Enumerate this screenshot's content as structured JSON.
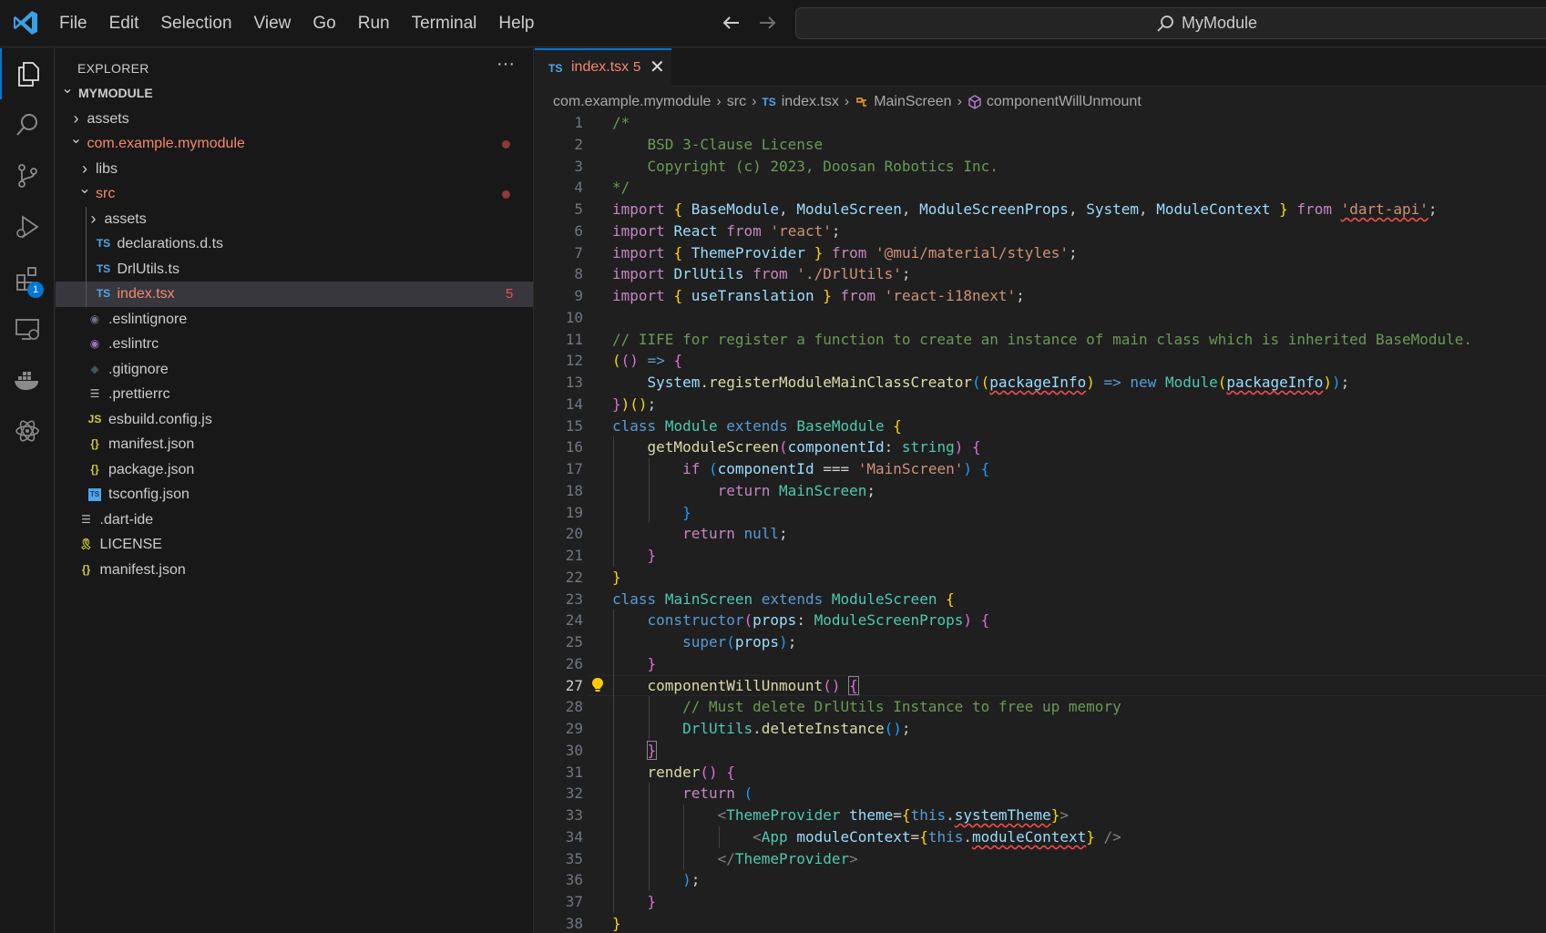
{
  "menu": [
    "File",
    "Edit",
    "Selection",
    "View",
    "Go",
    "Run",
    "Terminal",
    "Help"
  ],
  "search": {
    "text": "MyModule"
  },
  "activity": {
    "extensions_badge": "1"
  },
  "explorer": {
    "title": "EXPLORER",
    "more": "···",
    "tree": [
      {
        "label": "MYMODULE",
        "depth": 0,
        "chev": "open",
        "icon": "",
        "root": true
      },
      {
        "label": "assets",
        "depth": 1,
        "chev": "closed",
        "icon": ""
      },
      {
        "label": "com.example.mymodule",
        "depth": 1,
        "chev": "open",
        "icon": "",
        "modified": true,
        "color": "#f48771"
      },
      {
        "label": "libs",
        "depth": 2,
        "chev": "closed",
        "icon": ""
      },
      {
        "label": "src",
        "depth": 2,
        "chev": "open",
        "icon": "",
        "modified": true,
        "color": "#f48771"
      },
      {
        "label": "assets",
        "depth": 3,
        "chev": "closed",
        "icon": ""
      },
      {
        "label": "declarations.d.ts",
        "depth": 3,
        "icon": "TS",
        "iconColor": "#4fa6ed"
      },
      {
        "label": "DrlUtils.ts",
        "depth": 3,
        "icon": "TS",
        "iconColor": "#4fa6ed"
      },
      {
        "label": "index.tsx",
        "depth": 3,
        "icon": "TS",
        "iconColor": "#4fa6ed",
        "selected": true,
        "color": "#f48771",
        "count": "5"
      },
      {
        "label": ".eslintignore",
        "depth": 2,
        "icon": "◉",
        "iconColor": "#6b7387"
      },
      {
        "label": ".eslintrc",
        "depth": 2,
        "icon": "◉",
        "iconColor": "#a074c4"
      },
      {
        "label": ".gitignore",
        "depth": 2,
        "icon": "◆",
        "iconColor": "#41535b"
      },
      {
        "label": ".prettierrc",
        "depth": 2,
        "icon": "☰",
        "iconColor": "#bbbbbb"
      },
      {
        "label": "esbuild.config.js",
        "depth": 2,
        "icon": "JS",
        "iconColor": "#cbcb41"
      },
      {
        "label": "manifest.json",
        "depth": 2,
        "icon": "{}",
        "iconColor": "#cbcb41"
      },
      {
        "label": "package.json",
        "depth": 2,
        "icon": "{}",
        "iconColor": "#cbcb41"
      },
      {
        "label": "tsconfig.json",
        "depth": 2,
        "icon": "TS",
        "iconColor": "#4fa6ed",
        "boxed": true
      },
      {
        "label": ".dart-ide",
        "depth": 1,
        "icon": "☰",
        "iconColor": "#bbbbbb"
      },
      {
        "label": "LICENSE",
        "depth": 1,
        "icon": "🎗",
        "iconColor": "#cbcb41"
      },
      {
        "label": "manifest.json",
        "depth": 1,
        "icon": "{}",
        "iconColor": "#cbcb41"
      }
    ]
  },
  "tab": {
    "lang": "TS",
    "name": "index.tsx",
    "count": "5",
    "close": "✕"
  },
  "breadcrumb": {
    "package": "com.example.mymodule",
    "folder": "src",
    "lang": "TS",
    "file": "index.tsx",
    "class": "MainScreen",
    "method": "componentWillUnmount"
  },
  "editor": {
    "current_line": 27,
    "lines": [
      [
        [
          "c",
          "/*"
        ]
      ],
      [
        [
          "c",
          "    BSD 3-Clause License"
        ]
      ],
      [
        [
          "c",
          "    Copyright (c) 2023, Doosan Robotics Inc."
        ]
      ],
      [
        [
          "c",
          "*/"
        ]
      ],
      [
        [
          "ki",
          "import"
        ],
        [
          "p",
          " "
        ],
        [
          "b1",
          "{"
        ],
        [
          "p",
          " "
        ],
        [
          "v",
          "BaseModule"
        ],
        [
          "p",
          ", "
        ],
        [
          "v",
          "ModuleScreen"
        ],
        [
          "p",
          ", "
        ],
        [
          "v",
          "ModuleScreenProps"
        ],
        [
          "p",
          ", "
        ],
        [
          "v",
          "System"
        ],
        [
          "p",
          ", "
        ],
        [
          "v",
          "ModuleContext"
        ],
        [
          "p",
          " "
        ],
        [
          "b1",
          "}"
        ],
        [
          "p",
          " "
        ],
        [
          "ki",
          "from"
        ],
        [
          "p",
          " "
        ],
        [
          "s sq",
          "'dart-api'"
        ],
        [
          "p",
          ";"
        ]
      ],
      [
        [
          "ki",
          "import"
        ],
        [
          "p",
          " "
        ],
        [
          "v",
          "React"
        ],
        [
          "p",
          " "
        ],
        [
          "ki",
          "from"
        ],
        [
          "p",
          " "
        ],
        [
          "s",
          "'react'"
        ],
        [
          "p",
          ";"
        ]
      ],
      [
        [
          "ki",
          "import"
        ],
        [
          "p",
          " "
        ],
        [
          "b1",
          "{"
        ],
        [
          "p",
          " "
        ],
        [
          "v",
          "ThemeProvider"
        ],
        [
          "p",
          " "
        ],
        [
          "b1",
          "}"
        ],
        [
          "p",
          " "
        ],
        [
          "ki",
          "from"
        ],
        [
          "p",
          " "
        ],
        [
          "s",
          "'@mui/material/styles'"
        ],
        [
          "p",
          ";"
        ]
      ],
      [
        [
          "ki",
          "import"
        ],
        [
          "p",
          " "
        ],
        [
          "v",
          "DrlUtils"
        ],
        [
          "p",
          " "
        ],
        [
          "ki",
          "from"
        ],
        [
          "p",
          " "
        ],
        [
          "s",
          "'./DrlUtils'"
        ],
        [
          "p",
          ";"
        ]
      ],
      [
        [
          "ki",
          "import"
        ],
        [
          "p",
          " "
        ],
        [
          "b1",
          "{"
        ],
        [
          "p",
          " "
        ],
        [
          "v",
          "useTranslation"
        ],
        [
          "p",
          " "
        ],
        [
          "b1",
          "}"
        ],
        [
          "p",
          " "
        ],
        [
          "ki",
          "from"
        ],
        [
          "p",
          " "
        ],
        [
          "s",
          "'react-i18next'"
        ],
        [
          "p",
          ";"
        ]
      ],
      [
        [
          "p",
          ""
        ]
      ],
      [
        [
          "c",
          "// IIFE for register a function to create an instance of main class which is inherited BaseModule."
        ]
      ],
      [
        [
          "b1",
          "("
        ],
        [
          "b2",
          "("
        ],
        [
          "b2",
          ")"
        ],
        [
          "p",
          " "
        ],
        [
          "k",
          "=>"
        ],
        [
          "p",
          " "
        ],
        [
          "b2",
          "{"
        ]
      ],
      [
        [
          "p",
          "    "
        ],
        [
          "v",
          "System"
        ],
        [
          "p",
          "."
        ],
        [
          "f",
          "registerModuleMainClassCreator"
        ],
        [
          "b3",
          "("
        ],
        [
          "b1",
          "("
        ],
        [
          "v sq",
          "packageInfo"
        ],
        [
          "b1",
          ")"
        ],
        [
          "p",
          " "
        ],
        [
          "k",
          "=>"
        ],
        [
          "p",
          " "
        ],
        [
          "k",
          "new"
        ],
        [
          "p",
          " "
        ],
        [
          "t",
          "Module"
        ],
        [
          "b1",
          "("
        ],
        [
          "v sq",
          "packageInfo"
        ],
        [
          "b1",
          ")"
        ],
        [
          "b3",
          ")"
        ],
        [
          "p",
          ";"
        ]
      ],
      [
        [
          "b2",
          "}"
        ],
        [
          "b1",
          ")"
        ],
        [
          "b1",
          "("
        ],
        [
          "b1",
          ")"
        ],
        [
          "p",
          ";"
        ]
      ],
      [
        [
          "k",
          "class"
        ],
        [
          "p",
          " "
        ],
        [
          "t",
          "Module"
        ],
        [
          "p",
          " "
        ],
        [
          "k",
          "extends"
        ],
        [
          "p",
          " "
        ],
        [
          "t",
          "BaseModule"
        ],
        [
          "p",
          " "
        ],
        [
          "b1",
          "{"
        ]
      ],
      [
        [
          "p",
          "    "
        ],
        [
          "f",
          "getModuleScreen"
        ],
        [
          "b2",
          "("
        ],
        [
          "v",
          "componentId"
        ],
        [
          "p",
          ": "
        ],
        [
          "t",
          "string"
        ],
        [
          "b2",
          ")"
        ],
        [
          "p",
          " "
        ],
        [
          "b2",
          "{"
        ]
      ],
      [
        [
          "p",
          "        "
        ],
        [
          "ki",
          "if"
        ],
        [
          "p",
          " "
        ],
        [
          "b3",
          "("
        ],
        [
          "v",
          "componentId"
        ],
        [
          "p",
          " === "
        ],
        [
          "s",
          "'MainScreen'"
        ],
        [
          "b3",
          ")"
        ],
        [
          "p",
          " "
        ],
        [
          "b3",
          "{"
        ]
      ],
      [
        [
          "p",
          "            "
        ],
        [
          "ki",
          "return"
        ],
        [
          "p",
          " "
        ],
        [
          "t",
          "MainScreen"
        ],
        [
          "p",
          ";"
        ]
      ],
      [
        [
          "p",
          "        "
        ],
        [
          "b3",
          "}"
        ]
      ],
      [
        [
          "p",
          "        "
        ],
        [
          "ki",
          "return"
        ],
        [
          "p",
          " "
        ],
        [
          "k",
          "null"
        ],
        [
          "p",
          ";"
        ]
      ],
      [
        [
          "p",
          "    "
        ],
        [
          "b2",
          "}"
        ]
      ],
      [
        [
          "b1",
          "}"
        ]
      ],
      [
        [
          "k",
          "class"
        ],
        [
          "p",
          " "
        ],
        [
          "t",
          "MainScreen"
        ],
        [
          "p",
          " "
        ],
        [
          "k",
          "extends"
        ],
        [
          "p",
          " "
        ],
        [
          "t",
          "ModuleScreen"
        ],
        [
          "p",
          " "
        ],
        [
          "b1",
          "{"
        ]
      ],
      [
        [
          "p",
          "    "
        ],
        [
          "k",
          "constructor"
        ],
        [
          "b2",
          "("
        ],
        [
          "v",
          "props"
        ],
        [
          "p",
          ": "
        ],
        [
          "t",
          "ModuleScreenProps"
        ],
        [
          "b2",
          ")"
        ],
        [
          "p",
          " "
        ],
        [
          "b2",
          "{"
        ]
      ],
      [
        [
          "p",
          "        "
        ],
        [
          "k",
          "super"
        ],
        [
          "b3",
          "("
        ],
        [
          "v",
          "props"
        ],
        [
          "b3",
          ")"
        ],
        [
          "p",
          ";"
        ]
      ],
      [
        [
          "p",
          "    "
        ],
        [
          "b2",
          "}"
        ]
      ],
      [
        [
          "p",
          "    "
        ],
        [
          "f",
          "componentWillUnmount"
        ],
        [
          "b2",
          "("
        ],
        [
          "b2",
          ")"
        ],
        [
          "p",
          " "
        ],
        [
          "b2 cur-br",
          "{"
        ]
      ],
      [
        [
          "p",
          "        "
        ],
        [
          "c",
          "// Must delete DrlUtils Instance to free up memory"
        ]
      ],
      [
        [
          "p",
          "        "
        ],
        [
          "t",
          "DrlUtils"
        ],
        [
          "p",
          "."
        ],
        [
          "f",
          "deleteInstance"
        ],
        [
          "b3",
          "("
        ],
        [
          "b3",
          ")"
        ],
        [
          "p",
          ";"
        ]
      ],
      [
        [
          "p",
          "    "
        ],
        [
          "b2 cur-br",
          "}"
        ]
      ],
      [
        [
          "p",
          "    "
        ],
        [
          "f",
          "render"
        ],
        [
          "b2",
          "("
        ],
        [
          "b2",
          ")"
        ],
        [
          "p",
          " "
        ],
        [
          "b2",
          "{"
        ]
      ],
      [
        [
          "p",
          "        "
        ],
        [
          "ki",
          "return"
        ],
        [
          "p",
          " "
        ],
        [
          "b3",
          "("
        ]
      ],
      [
        [
          "p",
          "            "
        ],
        [
          "tg",
          "<"
        ],
        [
          "t",
          "ThemeProvider"
        ],
        [
          "p",
          " "
        ],
        [
          "v",
          "theme"
        ],
        [
          "p",
          "="
        ],
        [
          "b1",
          "{"
        ],
        [
          "k",
          "this"
        ],
        [
          "p",
          "."
        ],
        [
          "v sq",
          "systemTheme"
        ],
        [
          "b1",
          "}"
        ],
        [
          "tg",
          ">"
        ]
      ],
      [
        [
          "p",
          "                "
        ],
        [
          "tg",
          "<"
        ],
        [
          "t",
          "App"
        ],
        [
          "p",
          " "
        ],
        [
          "v",
          "moduleContext"
        ],
        [
          "p",
          "="
        ],
        [
          "b1",
          "{"
        ],
        [
          "k",
          "this"
        ],
        [
          "p",
          "."
        ],
        [
          "v sq",
          "moduleContext"
        ],
        [
          "b1",
          "}"
        ],
        [
          "p",
          " "
        ],
        [
          "tg",
          "/>"
        ]
      ],
      [
        [
          "p",
          "            "
        ],
        [
          "tg",
          "</"
        ],
        [
          "t",
          "ThemeProvider"
        ],
        [
          "tg",
          ">"
        ]
      ],
      [
        [
          "p",
          "        "
        ],
        [
          "b3",
          ")"
        ],
        [
          "p",
          ";"
        ]
      ],
      [
        [
          "p",
          "    "
        ],
        [
          "b2",
          "}"
        ]
      ],
      [
        [
          "b1",
          "}"
        ]
      ]
    ]
  },
  "colors": {
    "accent": "#0078d4",
    "error": "#f14c4c",
    "modified": "#f48771"
  }
}
